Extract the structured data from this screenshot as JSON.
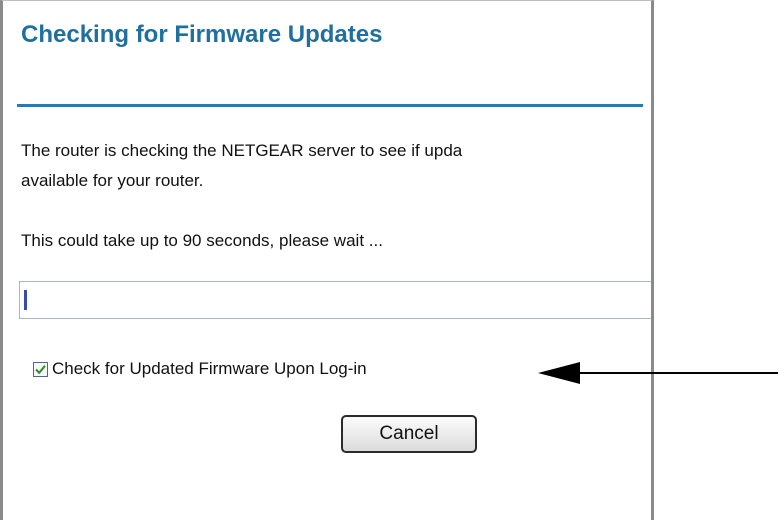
{
  "dialog": {
    "title": "Checking for Firmware Updates",
    "message_line1": "The router is checking the NETGEAR server to see if upda",
    "message_line2": "available for your router.",
    "wait_message": "This could take up to 90 seconds, please wait ..."
  },
  "progress": {
    "level_percent": 1
  },
  "firmware_check": {
    "label": "Check for Updated Firmware Upon Log-in",
    "checked": true
  },
  "buttons": {
    "cancel_label": "Cancel"
  },
  "colors": {
    "title": "#1f6f9f",
    "rule": "#1e7fb8",
    "progress_fill": "#3b4bb0",
    "checkmark": "#2e8b2e"
  },
  "icons": {
    "checkbox": "checkmark-icon",
    "callout": "arrow-left-icon"
  }
}
